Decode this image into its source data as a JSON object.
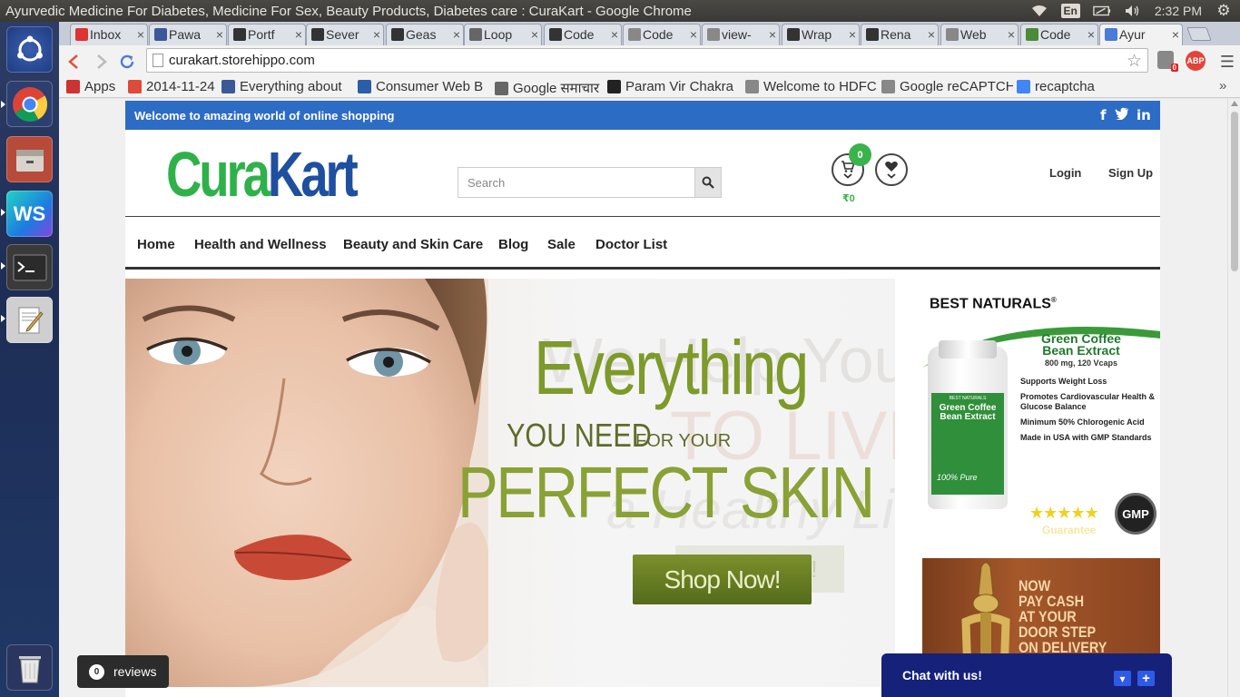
{
  "window": {
    "title": "Ayurvedic Medicine For Diabetes, Medicine For Sex, Beauty Products, Diabetes care : CuraKart - Google Chrome",
    "lang": "En",
    "clock": "2:32 PM"
  },
  "tabs": [
    {
      "label": "Inbox",
      "favicon": "gmail-icon",
      "color": "#d33"
    },
    {
      "label": "Pawa",
      "favicon": "facebook-icon",
      "color": "#3b5998"
    },
    {
      "label": "Portf",
      "favicon": "wordpress-icon",
      "color": "#333"
    },
    {
      "label": "Sever",
      "favicon": "wordpress-icon",
      "color": "#333"
    },
    {
      "label": "Geas",
      "favicon": "wordpress-icon",
      "color": "#333"
    },
    {
      "label": "Loop",
      "favicon": "link-icon",
      "color": "#666"
    },
    {
      "label": "Code",
      "favicon": "wordpress-icon",
      "color": "#333"
    },
    {
      "label": "Code",
      "favicon": "page-icon",
      "color": "#888"
    },
    {
      "label": "view-",
      "favicon": "page-icon",
      "color": "#888"
    },
    {
      "label": "Wrap",
      "favicon": "wordpress-icon",
      "color": "#333"
    },
    {
      "label": "Rena",
      "favicon": "wordpress-icon",
      "color": "#333"
    },
    {
      "label": "Web",
      "favicon": "page-icon",
      "color": "#888"
    },
    {
      "label": "Code",
      "favicon": "w3schools-icon",
      "color": "#4a8a3a"
    },
    {
      "label": "Ayur",
      "favicon": "chart-icon",
      "color": "#4a7bd6"
    }
  ],
  "address": {
    "url": "curakart.storehippo.com"
  },
  "extensions": {
    "badge": "0",
    "abp": "ABP"
  },
  "bookmarks": [
    {
      "label": "Apps",
      "icon": "apps-icon",
      "color": "#c33"
    },
    {
      "label": "2014-11-24",
      "icon": "gplus-icon",
      "color": "#dd4b39"
    },
    {
      "label": "Everything about",
      "icon": "facebook-icon",
      "color": "#3b5998"
    },
    {
      "label": "Consumer Web B",
      "icon": "cw-icon",
      "color": "#2a5ea8"
    },
    {
      "label": "Google समाचार",
      "icon": "news-icon",
      "color": "#666"
    },
    {
      "label": "Param Vir Chakra",
      "icon": "wikipedia-icon",
      "color": "#222"
    },
    {
      "label": "Welcome to HDFC",
      "icon": "page-icon",
      "color": "#888"
    },
    {
      "label": "Google reCAPTCH",
      "icon": "page-icon",
      "color": "#888"
    },
    {
      "label": "recaptcha",
      "icon": "google-icon",
      "color": "#4285f4"
    }
  ],
  "site": {
    "welcome": "Welcome to amazing world of online shopping",
    "social": [
      "f",
      "t",
      "in"
    ],
    "logo_part1": "Cura",
    "logo_part2": "Kart",
    "search_placeholder": "Search",
    "cart_count": "0",
    "cart_amount": "₹0",
    "login": "Login",
    "signup": "Sign Up",
    "nav": [
      "Home",
      "Health and Wellness",
      "Beauty and Skin Care",
      "Blog",
      "Sale",
      "Doctor List"
    ]
  },
  "hero": {
    "line1": "Everything",
    "line2a": "YOU NEED",
    "line2b": "FOR YOUR",
    "line3": "PERFECT SKIN",
    "cta": "Shop Now!",
    "ghost1": "We Help You",
    "ghost2": "TO LIVE",
    "ghost3": "a Healthy Life",
    "ghost_cta": "Shop Now!"
  },
  "ad1": {
    "brand": "BEST NATURALS",
    "reg": "®",
    "product1": "Green Coffee",
    "product2": "Bean Extract",
    "spec": "800 mg, 120 Vcaps",
    "bullets": [
      "Supports Weight Loss",
      "Promotes Cardiovascular Health & Glucose Balance",
      "Minimum 50% Chlorogenic Acid",
      "Made in USA with GMP Standards"
    ],
    "bottle_brand": "BEST NATURALS",
    "bottle_line1": "Green Coffee",
    "bottle_line2": "Bean Extract",
    "bottle_pure": "100% Pure",
    "stars": "★★★★★",
    "guarantee": "Guarantee",
    "gmp": "GMP"
  },
  "ad2": {
    "line1": "NOW",
    "line2": "PAY CASH",
    "line3": "AT YOUR",
    "line4": "DOOR STEP",
    "line5": "ON DELIVERY"
  },
  "widgets": {
    "reviews_count": "0",
    "reviews_label": "reviews",
    "chat_label": "Chat with us!",
    "chat_min": "▾",
    "chat_max": "+"
  }
}
